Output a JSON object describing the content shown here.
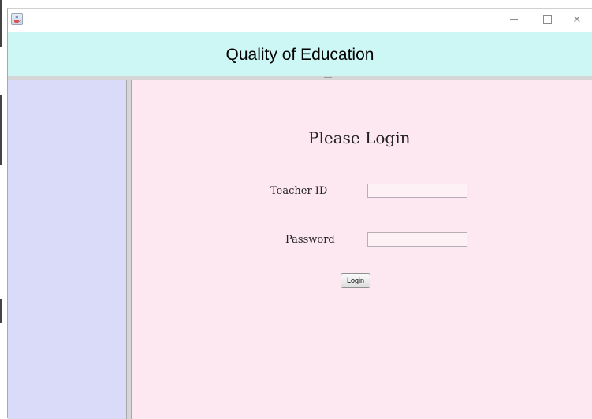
{
  "window": {
    "icon": "java-cup-icon",
    "controls": {
      "minimize_icon": "minimize-icon",
      "maximize_icon": "maximize-icon",
      "close_icon": "close-icon",
      "close_glyph": "✕"
    }
  },
  "header": {
    "title": "Quality of Education",
    "background": "#cdf7f5"
  },
  "sidebar": {
    "background": "#d9dbf8"
  },
  "login": {
    "background": "#fde7f1",
    "title": "Please Login",
    "teacher_id_label": "Teacher ID",
    "teacher_id_value": "",
    "password_label": "Password",
    "password_value": "",
    "login_button": "Login"
  }
}
